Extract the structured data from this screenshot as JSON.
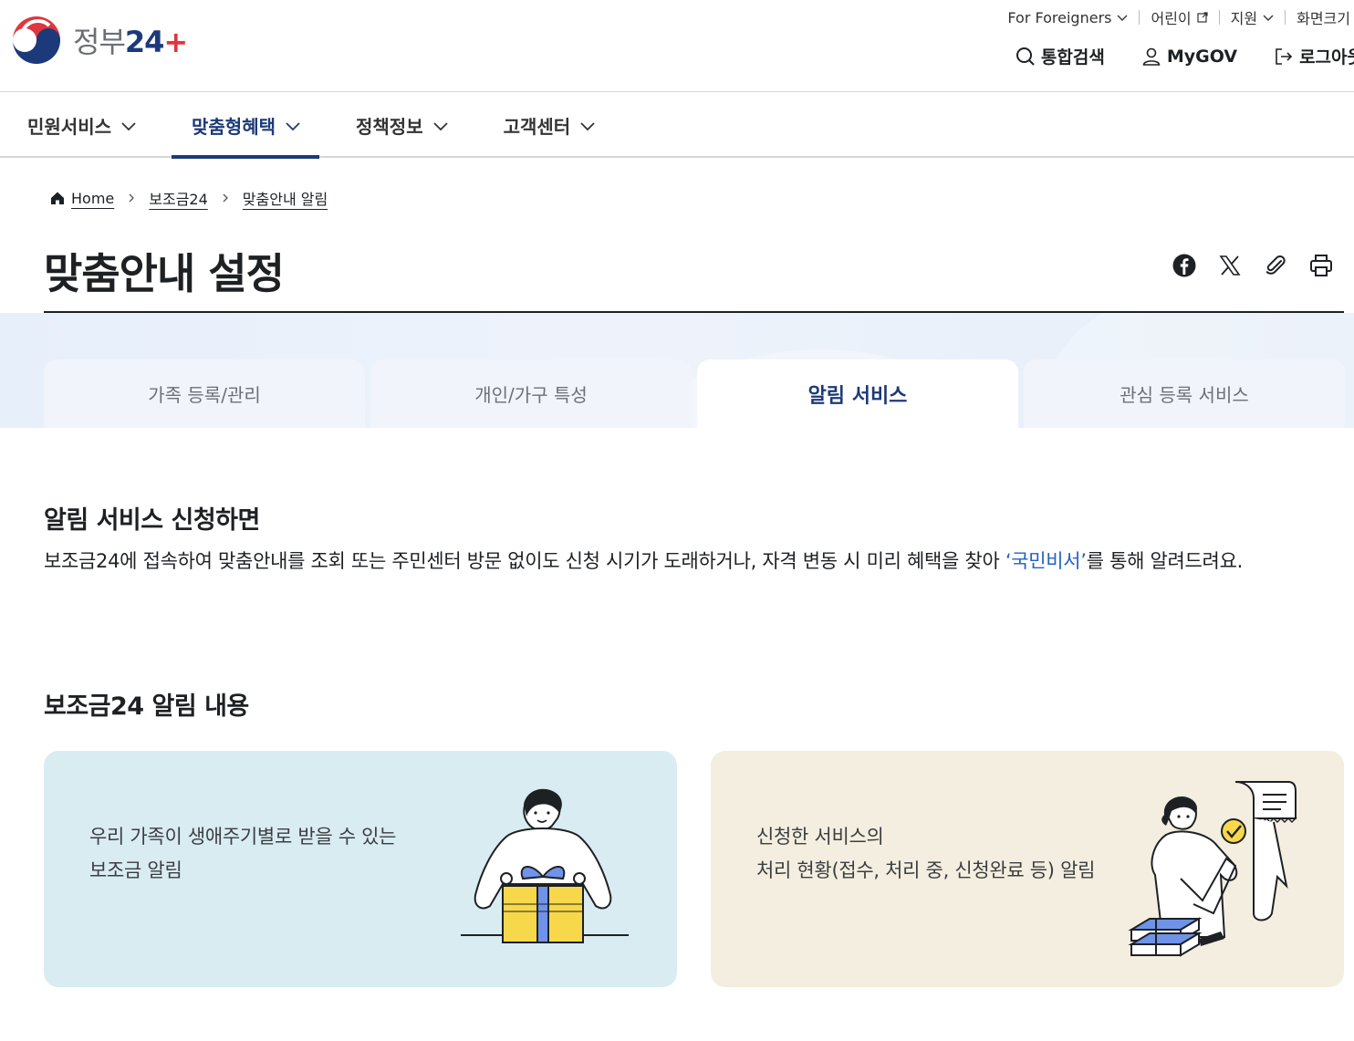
{
  "header": {
    "logo_text": "정부",
    "logo_num": "24",
    "util": {
      "foreigners": "For Foreigners",
      "kids": "어린이",
      "support": "지원",
      "font_size": "화면크기"
    },
    "actions": {
      "search": "통합검색",
      "mygov": "MyGOV",
      "logout": "로그아웃"
    }
  },
  "gnb": {
    "items": [
      {
        "label": "민원서비스"
      },
      {
        "label": "맞춤형혜택"
      },
      {
        "label": "정책정보"
      },
      {
        "label": "고객센터"
      }
    ]
  },
  "breadcrumb": {
    "home": "Home",
    "level1": "보조금24",
    "level2": "맞춤안내 알림"
  },
  "page": {
    "title": "맞춤안내 설정"
  },
  "tabs": [
    {
      "label": "가족 등록/관리"
    },
    {
      "label": "개인/가구 특성"
    },
    {
      "label": "알림 서비스"
    },
    {
      "label": "관심 등록 서비스"
    }
  ],
  "section1": {
    "heading": "알림 서비스 신청하면",
    "desc_before": "보조금24에 접속하여 맞춤안내를 조회 또는 주민센터 방문 없이도 신청 시기가 도래하거나, 자격 변동 시 미리 혜택을 찾아 ",
    "desc_highlight": "‘국민비서’",
    "desc_after": "를 통해 알려드려요."
  },
  "section2": {
    "heading": "보조금24 알림 내용",
    "cards": [
      {
        "line1": "우리 가족이 생애주기별로 받을 수 있는",
        "line2": "보조금 알림"
      },
      {
        "line1": "신청한 서비스의",
        "line2": "처리 현황(접수, 처리 중, 신청완료 등) 알림"
      }
    ]
  },
  "colors": {
    "brand_navy": "#1c3a79",
    "accent_red": "#e0363f",
    "link_blue": "#2561c6",
    "card_blue": "#d9ecf2",
    "card_beige": "#f3eedf"
  }
}
